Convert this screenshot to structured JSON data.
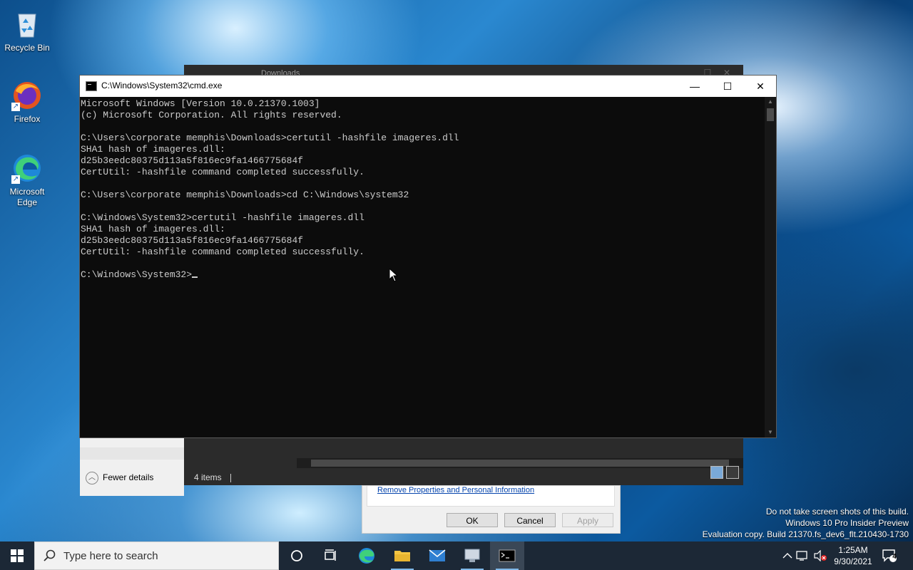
{
  "desktop_icons": [
    {
      "label": "Recycle Bin",
      "icon": "recycle-bin-icon"
    },
    {
      "label": "Firefox",
      "icon": "firefox-icon"
    },
    {
      "label": "Microsoft Edge",
      "icon": "edge-icon"
    }
  ],
  "explorer": {
    "title": "Downloads",
    "status_items": "4 items"
  },
  "properties_panel": {
    "fewer_details": "Fewer details"
  },
  "dialog": {
    "link": "Remove Properties and Personal Information",
    "ok": "OK",
    "cancel": "Cancel",
    "apply": "Apply"
  },
  "cmd": {
    "title": "C:\\Windows\\System32\\cmd.exe",
    "lines": [
      "Microsoft Windows [Version 10.0.21370.1003]",
      "(c) Microsoft Corporation. All rights reserved.",
      "",
      "C:\\Users\\corporate memphis\\Downloads>certutil -hashfile imageres.dll",
      "SHA1 hash of imageres.dll:",
      "d25b3eedc80375d113a5f816ec9fa1466775684f",
      "CertUtil: -hashfile command completed successfully.",
      "",
      "C:\\Users\\corporate memphis\\Downloads>cd C:\\Windows\\system32",
      "",
      "C:\\Windows\\System32>certutil -hashfile imageres.dll",
      "SHA1 hash of imageres.dll:",
      "d25b3eedc80375d113a5f816ec9fa1466775684f",
      "CertUtil: -hashfile command completed successfully.",
      ""
    ],
    "prompt": "C:\\Windows\\System32>"
  },
  "watermark": {
    "line1": "Do not take screen shots of this build.",
    "line2": "Windows 10 Pro Insider Preview",
    "line3": "Evaluation copy. Build 21370.fs_dev6_flt.210430-1730"
  },
  "taskbar": {
    "search_placeholder": "Type here to search",
    "time": "1:25AM",
    "date": "9/30/2021",
    "notification_count": "4"
  }
}
